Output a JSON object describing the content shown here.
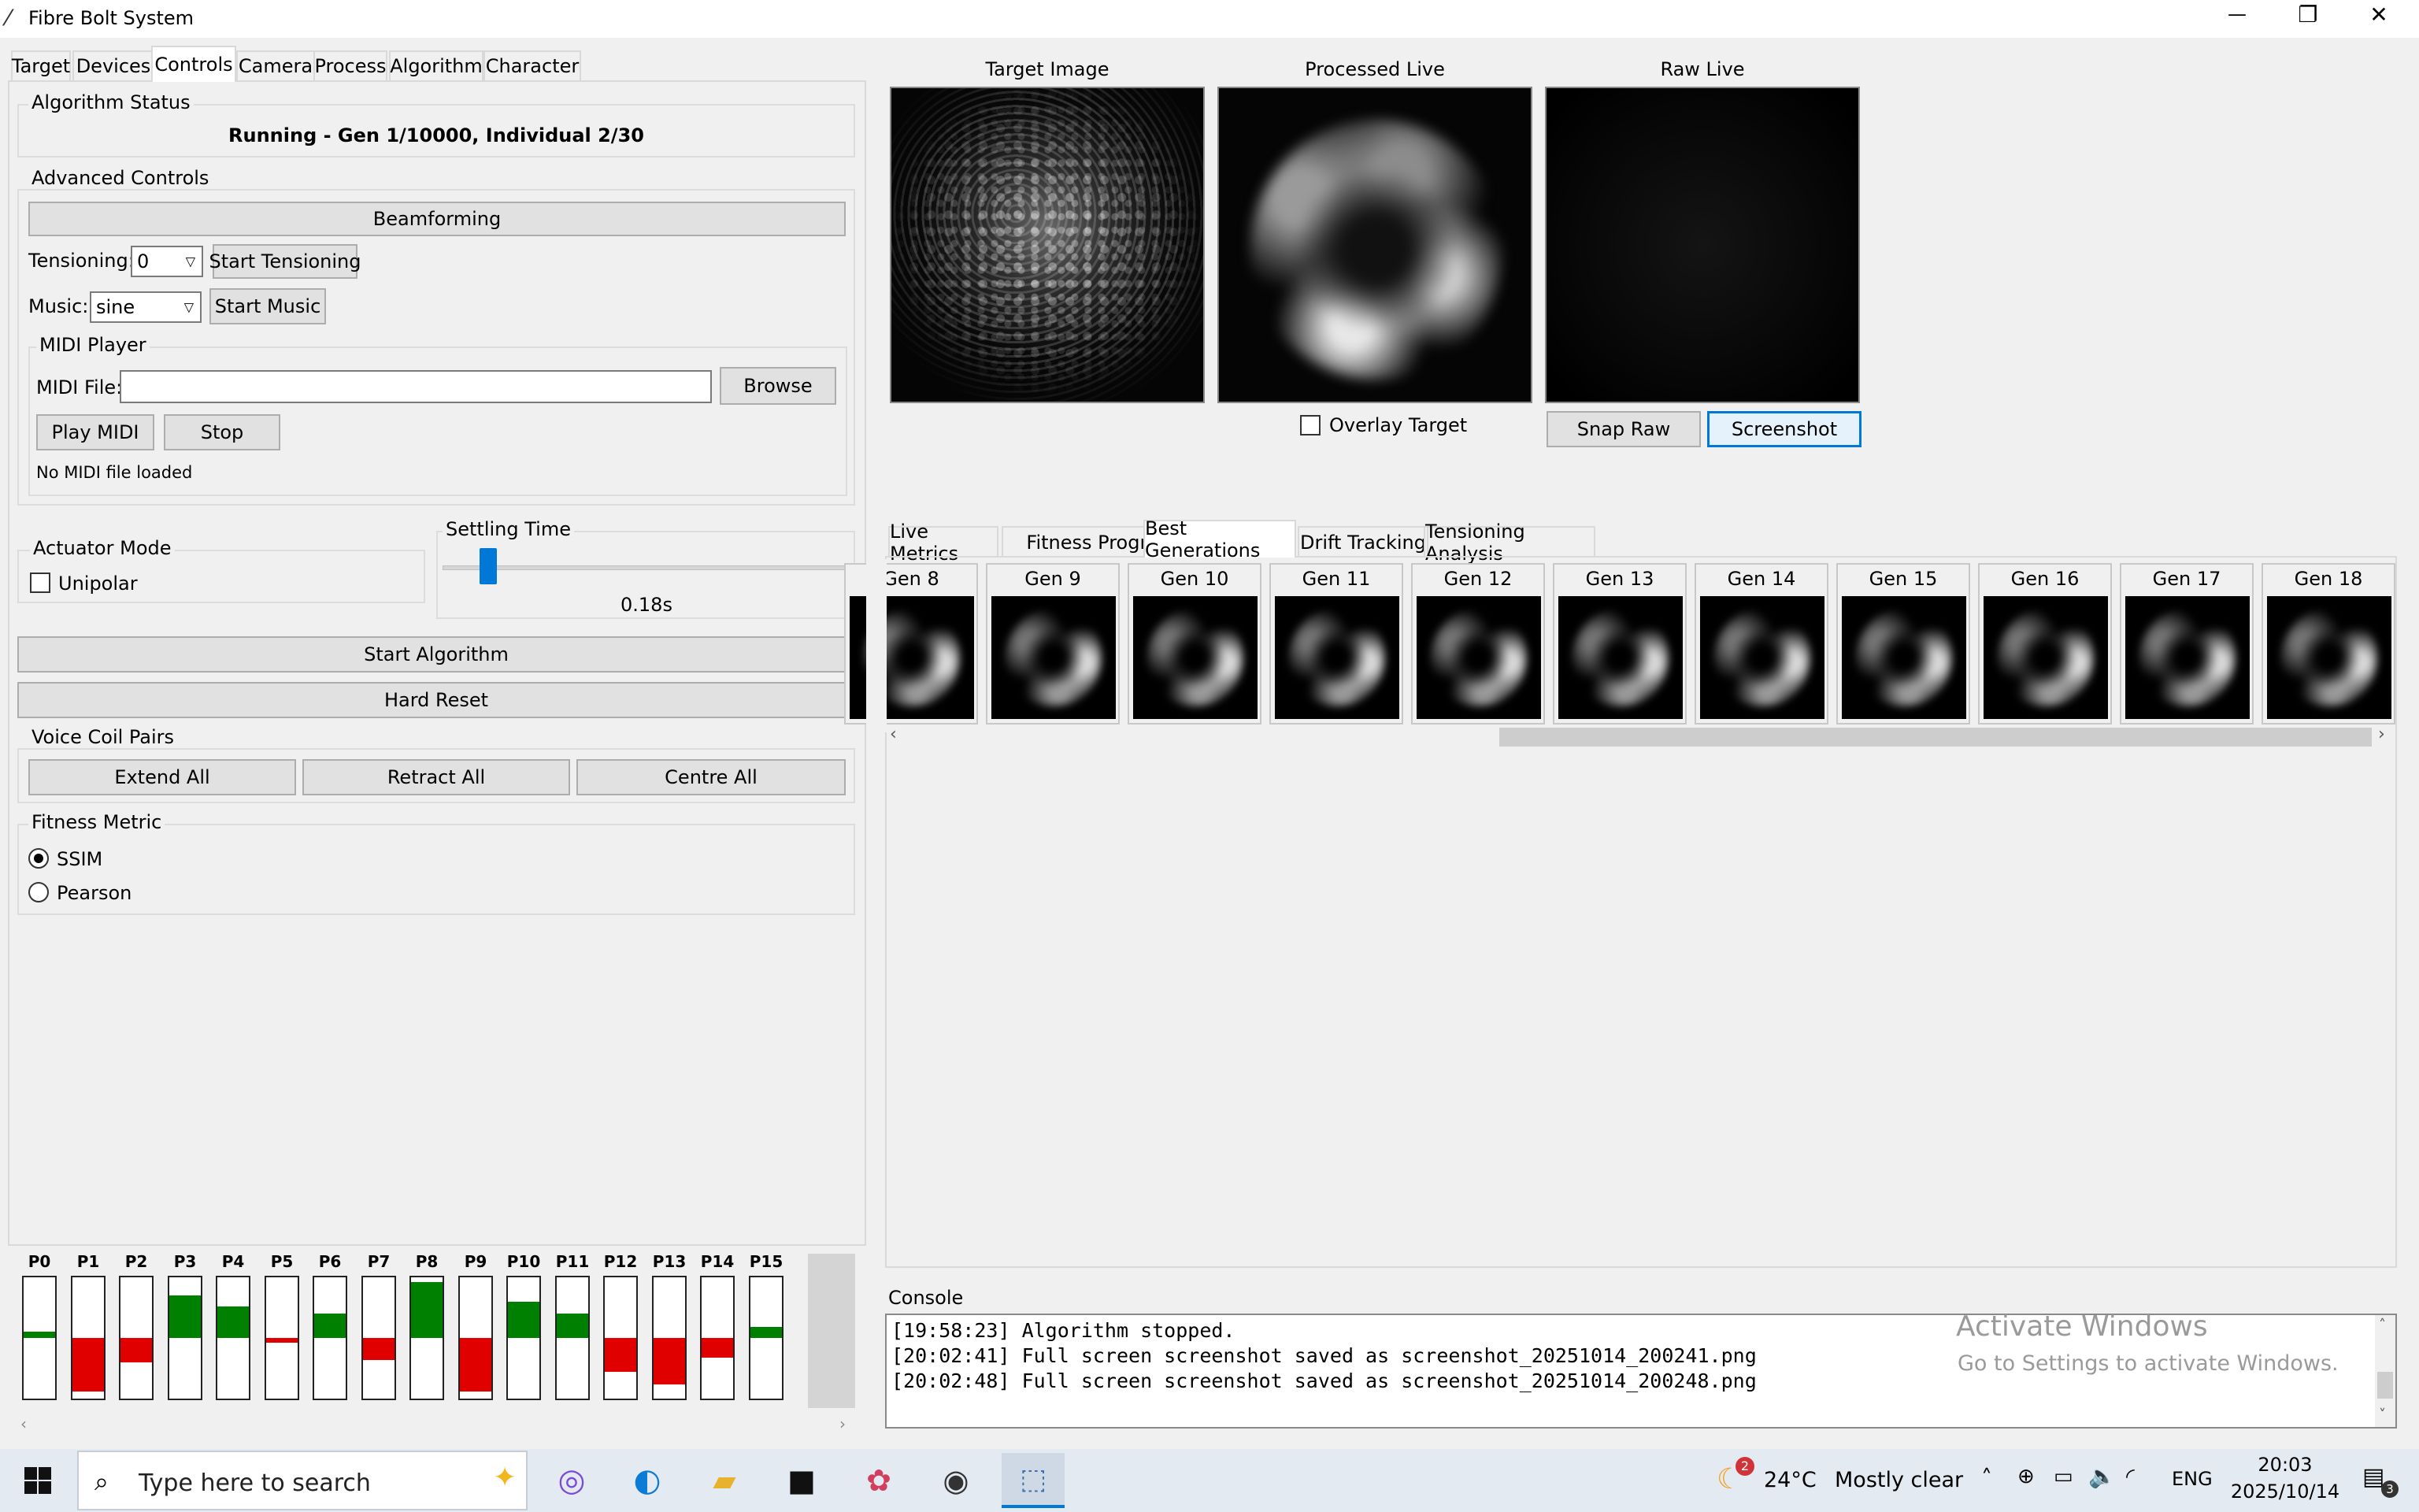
{
  "window": {
    "title": "Fibre Bolt System",
    "controls": {
      "minimize": "—",
      "restore": "❐",
      "close": "✕"
    }
  },
  "left_tabs": [
    "Target",
    "Devices",
    "Controls",
    "Camera",
    "Process",
    "Algorithm",
    "Character"
  ],
  "active_left_tab": "Controls",
  "algorithm_status": {
    "title": "Algorithm Status",
    "text": "Running - Gen 1/10000, Individual 2/30"
  },
  "advanced_controls": {
    "title": "Advanced Controls",
    "beamforming_label": "Beamforming",
    "tensioning_label": "Tensioning:",
    "tensioning_value": "0",
    "start_tensioning_label": "Start Tensioning",
    "music_label": "Music:",
    "music_value": "sine",
    "start_music_label": "Start Music"
  },
  "midi_player": {
    "title": "MIDI Player",
    "file_label": "MIDI File:",
    "file_value": "",
    "browse_label": "Browse",
    "play_label": "Play MIDI",
    "stop_label": "Stop",
    "status": "No MIDI file loaded"
  },
  "actuator_mode": {
    "title": "Actuator Mode",
    "unipolar_label": "Unipolar",
    "unipolar_checked": false
  },
  "settling_time": {
    "title": "Settling Time",
    "value_text": "0.18s",
    "slider_fraction": 0.05
  },
  "main_buttons": {
    "start_algorithm": "Start Algorithm",
    "hard_reset": "Hard Reset"
  },
  "voice_coil_pairs": {
    "title": "Voice Coil Pairs",
    "extend_all": "Extend All",
    "retract_all": "Retract All",
    "centre_all": "Centre All"
  },
  "fitness_metric": {
    "title": "Fitness Metric",
    "options": [
      "SSIM",
      "Pearson"
    ],
    "selected": "SSIM"
  },
  "pairs": [
    {
      "label": "P0",
      "color": "#008000",
      "from": 0.5,
      "to": 0.55
    },
    {
      "label": "P1",
      "color": "#e00000",
      "from": 0.06,
      "to": 0.5
    },
    {
      "label": "P2",
      "color": "#e00000",
      "from": 0.3,
      "to": 0.5
    },
    {
      "label": "P3",
      "color": "#008000",
      "from": 0.5,
      "to": 0.85
    },
    {
      "label": "P4",
      "color": "#008000",
      "from": 0.5,
      "to": 0.76
    },
    {
      "label": "P5",
      "color": "#e00000",
      "from": 0.46,
      "to": 0.5
    },
    {
      "label": "P6",
      "color": "#008000",
      "from": 0.5,
      "to": 0.7
    },
    {
      "label": "P7",
      "color": "#e00000",
      "from": 0.32,
      "to": 0.5
    },
    {
      "label": "P8",
      "color": "#008000",
      "from": 0.5,
      "to": 0.96
    },
    {
      "label": "P9",
      "color": "#e00000",
      "from": 0.06,
      "to": 0.5
    },
    {
      "label": "P10",
      "color": "#008000",
      "from": 0.5,
      "to": 0.8
    },
    {
      "label": "P11",
      "color": "#008000",
      "from": 0.5,
      "to": 0.7
    },
    {
      "label": "P12",
      "color": "#e00000",
      "from": 0.22,
      "to": 0.5
    },
    {
      "label": "P13",
      "color": "#e00000",
      "from": 0.12,
      "to": 0.5
    },
    {
      "label": "P14",
      "color": "#e00000",
      "from": 0.34,
      "to": 0.5
    },
    {
      "label": "P15",
      "color": "#008000",
      "from": 0.5,
      "to": 0.59
    }
  ],
  "images": {
    "target_title": "Target Image",
    "processed_title": "Processed Live",
    "raw_title": "Raw Live",
    "overlay_label": "Overlay Target",
    "snap_raw_label": "Snap Raw",
    "screenshot_label": "Screenshot"
  },
  "right_tabs": [
    "Live Metrics",
    "Fitness Progress",
    "Best Generations",
    "Drift Tracking",
    "Tensioning Analysis"
  ],
  "active_right_tab": "Best Generations",
  "generations": [
    "Gen 8",
    "Gen 9",
    "Gen 10",
    "Gen 11",
    "Gen 12",
    "Gen 13",
    "Gen 14",
    "Gen 15",
    "Gen 16",
    "Gen 17",
    "Gen 18"
  ],
  "console": {
    "title": "Console",
    "lines": [
      "[19:58:23] Algorithm stopped.",
      "[20:02:41] Full screen screenshot saved as screenshot_20251014_200241.png",
      "[20:02:48] Full screen screenshot saved as screenshot_20251014_200248.png"
    ]
  },
  "watermark": {
    "line1": "Activate Windows",
    "line2": "Go to Settings to activate Windows."
  },
  "taskbar": {
    "search_placeholder": "Type here to search",
    "weather_temp": "24°C",
    "weather_text": "Mostly clear",
    "weather_badge": "2",
    "lang": "ENG",
    "time": "20:03",
    "date": "2025/10/14",
    "notification_count": "3"
  }
}
